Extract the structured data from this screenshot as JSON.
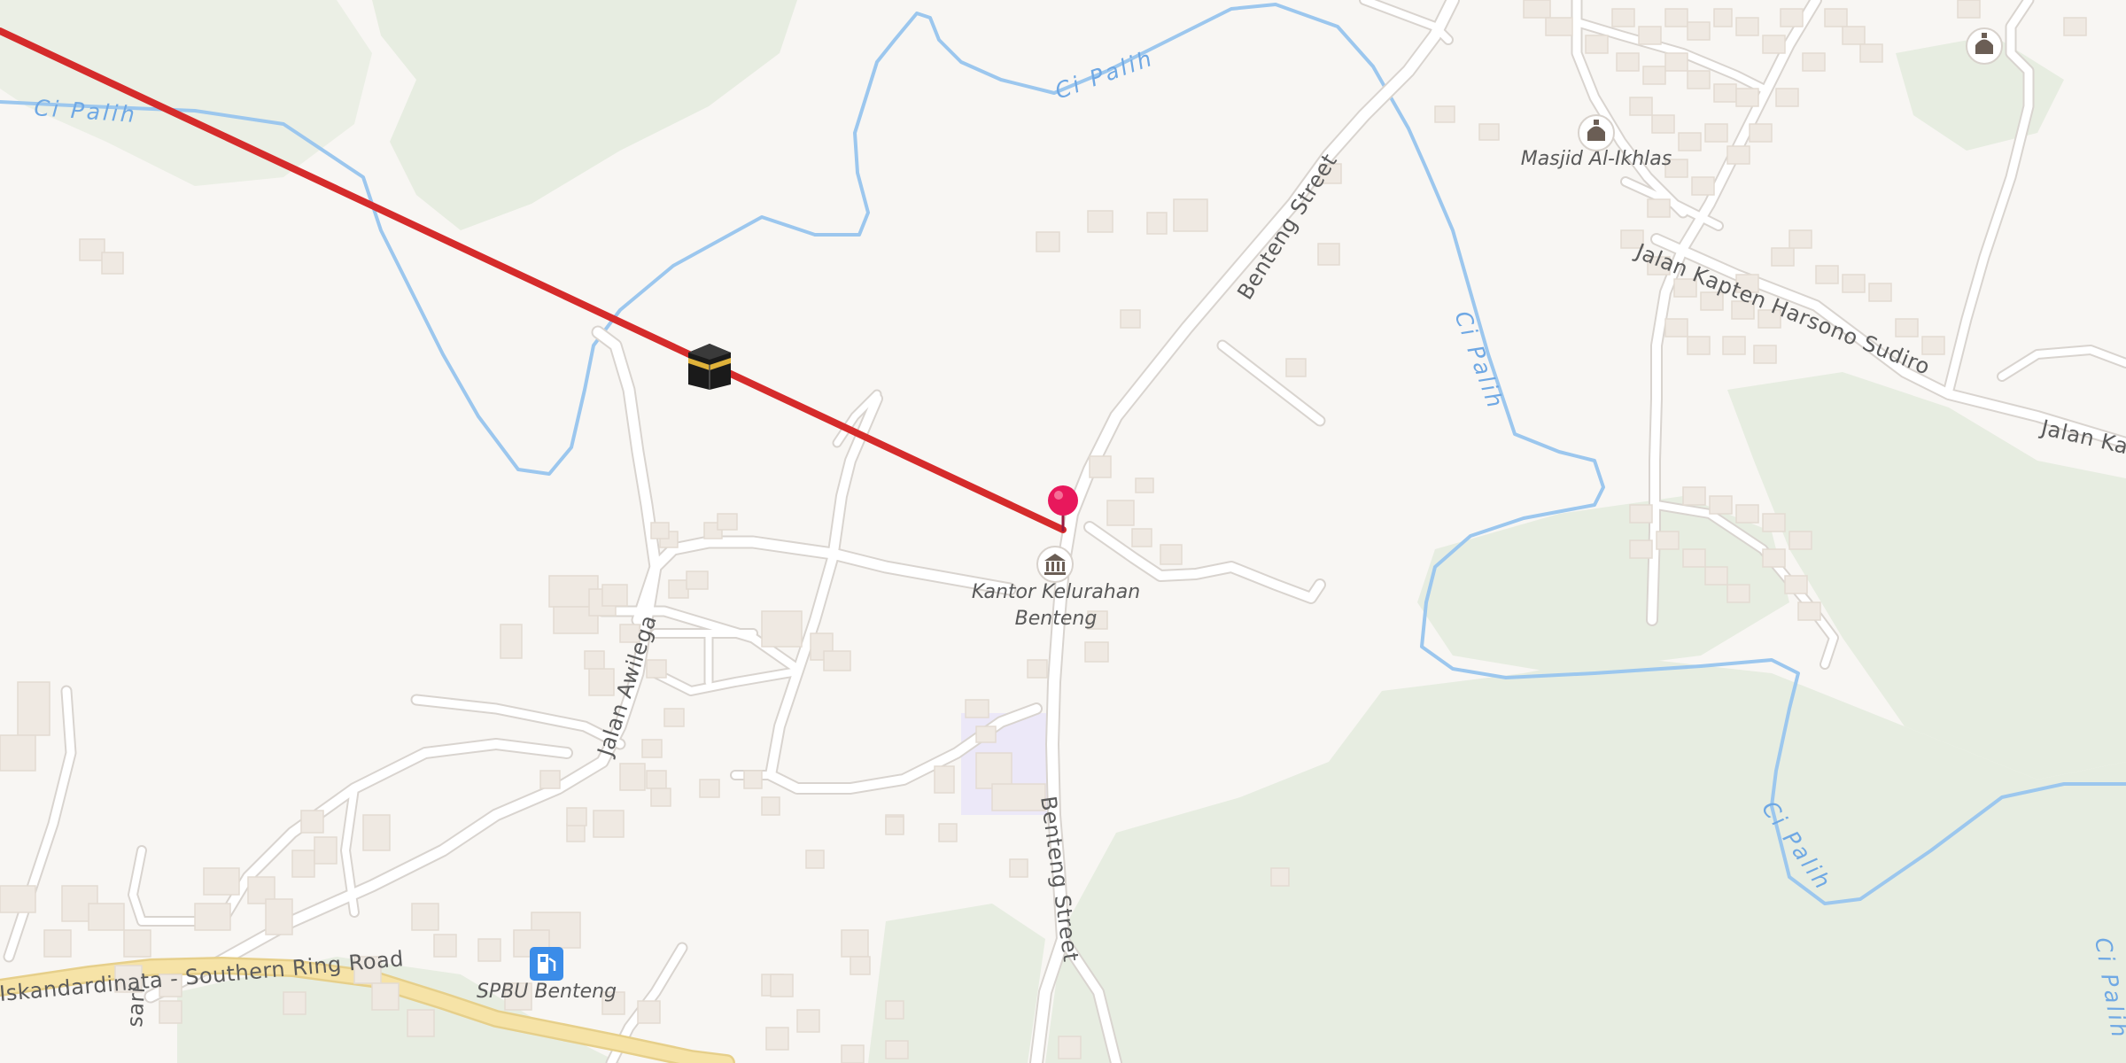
{
  "map": {
    "colors": {
      "background": "#f8f6f3",
      "green_area": "#e7ede1",
      "river": "#9cc7ee",
      "road": "#ffffff",
      "ring_road": "#f6e3a7",
      "building": "#efe9e2",
      "route_line": "#d52b2b",
      "pin": "#e8185c",
      "fuel_icon_bg": "#3b8ce8",
      "school_area": "#ece8f8"
    },
    "labels": {
      "river_top_left": "Ci Palih",
      "river_top_center": "Ci Palih",
      "river_right": "Ci Palih",
      "river_bottom_right": "Ci Palih",
      "river_far_right": "Ci Palih",
      "road_benteng_north": "Benteng Street",
      "road_benteng_south": "Benteng Street",
      "road_awilega": "Jalan Awilega",
      "road_kapten_harsono": "Jalan Kapten Harsono Sudiro",
      "road_kapten_harsono_cut": "Jalan Kap",
      "road_ring": "Iskandardinata - Southern Ring Road",
      "road_bottom_cut": "sari",
      "poi_masjid": "Masjid Al-Ikhlas",
      "poi_kantor_line1": "Kantor Kelurahan",
      "poi_kantor_line2": "Benteng",
      "poi_spbu": "SPBU Benteng"
    },
    "icons": {
      "kaaba": "kaaba-icon",
      "mosque": "mosque-icon",
      "government": "government-building-icon",
      "fuel": "fuel-station-icon",
      "pin": "location-pin-icon"
    }
  }
}
